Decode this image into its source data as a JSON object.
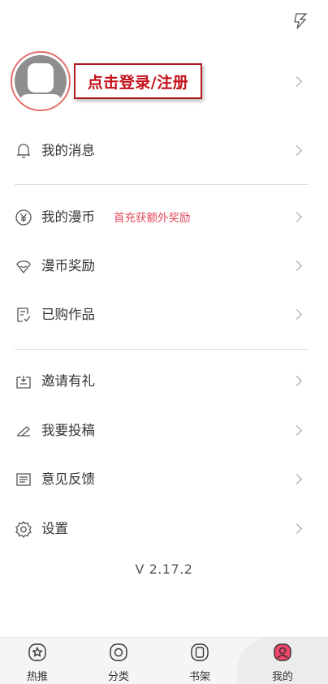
{
  "profile": {
    "login_label": "点击登录/注册"
  },
  "menu": {
    "messages": "我的消息",
    "coins": "我的漫币",
    "coins_promo": "首充获额外奖励",
    "rewards": "漫币奖励",
    "purchased": "已购作品",
    "invite": "邀请有礼",
    "submit": "我要投稿",
    "feedback": "意见反馈",
    "settings": "设置"
  },
  "version": "V 2.17.2",
  "tabs": [
    {
      "label": "热推",
      "icon": "star-icon"
    },
    {
      "label": "分类",
      "icon": "category-icon"
    },
    {
      "label": "书架",
      "icon": "bookshelf-icon"
    },
    {
      "label": "我的",
      "icon": "user-icon"
    }
  ],
  "colors": {
    "accent": "#e0485a",
    "login_border": "#b01c24",
    "login_text": "#c3111a",
    "active_tab": "#f0466a"
  }
}
